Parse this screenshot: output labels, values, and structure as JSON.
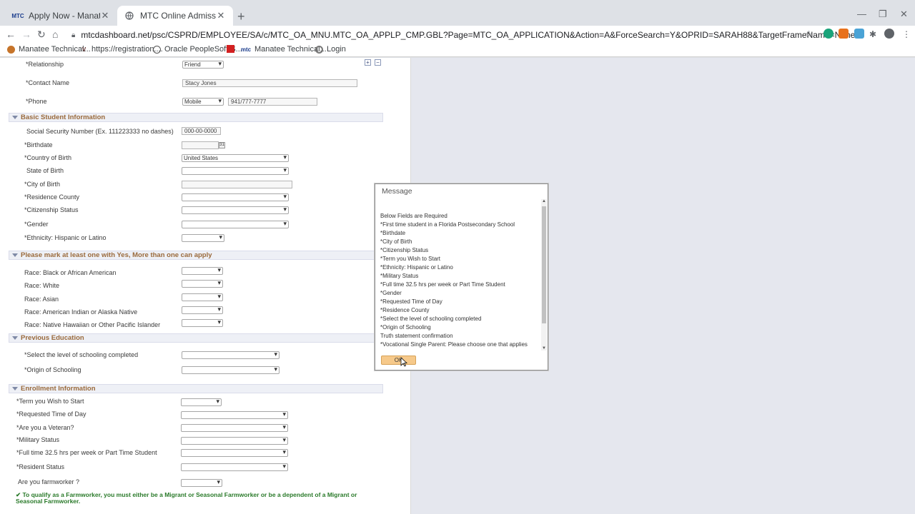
{
  "browser": {
    "tabs": [
      {
        "label": "Apply Now - Manatee Technical Inst",
        "favicon": "MTC",
        "active": false
      },
      {
        "label": "MTC Online Admission Appln",
        "favicon": "globe",
        "active": true
      }
    ],
    "url": "mtcdashboard.net/psc/CSPRD/EMPLOYEE/SA/c/MTC_OA_MNU.MTC_OA_APPLP_CMP.GBL?Page=MTC_OA_APPLICATION&Action=A&ForceSearch=Y&OPRID=SARAH88&TargetFrameName=None",
    "bookmarks": [
      {
        "label": "Manatee Technical..."
      },
      {
        "label": "https://registration...."
      },
      {
        "label": "Oracle PeopleSoft S..."
      },
      {
        "label": ""
      },
      {
        "label": "Manatee Technical..."
      },
      {
        "label": "Login"
      }
    ]
  },
  "form": {
    "emergency": {
      "relationship_label": "*Relationship",
      "relationship_value": "Friend",
      "contact_label": "*Contact Name",
      "contact_value": "Stacy Jones",
      "phone_label": "*Phone",
      "phone_type": "Mobile",
      "phone_value": "941/777-7777"
    },
    "basic": {
      "header": "Basic Student Information",
      "ssn_label": "Social Security Number (Ex. 111223333 no dashes)",
      "ssn_value": "000-00-0000",
      "birthdate_label": "*Birthdate",
      "country_label": "*Country of Birth",
      "country_value": "United States",
      "state_label": "State of Birth",
      "city_label": "*City of Birth",
      "county_label": "*Residence County",
      "citizenship_label": "*Citizenship Status",
      "gender_label": "*Gender",
      "ethnicity_label": "*Ethnicity: Hispanic or Latino"
    },
    "race": {
      "header": "Please mark at least one with Yes, More than one can apply",
      "items": [
        "Race: Black or African American",
        "Race: White",
        "Race: Asian",
        "Race: American Indian or Alaska Native",
        "Race: Native Hawaiian or Other Pacific Islander"
      ]
    },
    "education": {
      "header": "Previous Education",
      "level_label": "*Select the level of schooling completed",
      "origin_label": "*Origin of Schooling"
    },
    "enrollment": {
      "header": "Enrollment Information",
      "term_label": "*Term you Wish to Start",
      "time_label": "*Requested Time of Day",
      "veteran_label": "*Are you a Veteran?",
      "military_label": "*Military Status",
      "fulltime_label": "*Full time 32.5 hrs per week or Part Time Student",
      "resident_label": "*Resident Status",
      "farmworker_label": "Are you farmworker ?",
      "note": "✔ To qualify as a Farmworker, you must either be a Migrant or Seasonal Farmworker or be a dependent of a Migrant or Seasonal Farmworker."
    }
  },
  "dialog": {
    "title": "Message",
    "lines": [
      "Below Fields are Required",
      "*First time student in a Florida Postsecondary School",
      "*Birthdate",
      "*City of Birth",
      "*Citizenship Status",
      "*Term you Wish to Start",
      "*Ethnicity: Hispanic or Latino",
      "*Military Status",
      "*Full time 32.5 hrs per week or Part Time Student",
      "*Gender",
      "*Requested Time of Day",
      "*Residence County",
      "*Select the level of schooling completed",
      "*Origin of Schooling",
      "Truth statement confirmation",
      "*Vocational Single Parent: Please choose one that applies"
    ],
    "ok_label": "OK"
  },
  "colors": {
    "section_header_text": "#9a6a3c",
    "ok_button": "#f6c98a",
    "note_green": "#2a7a2a"
  }
}
